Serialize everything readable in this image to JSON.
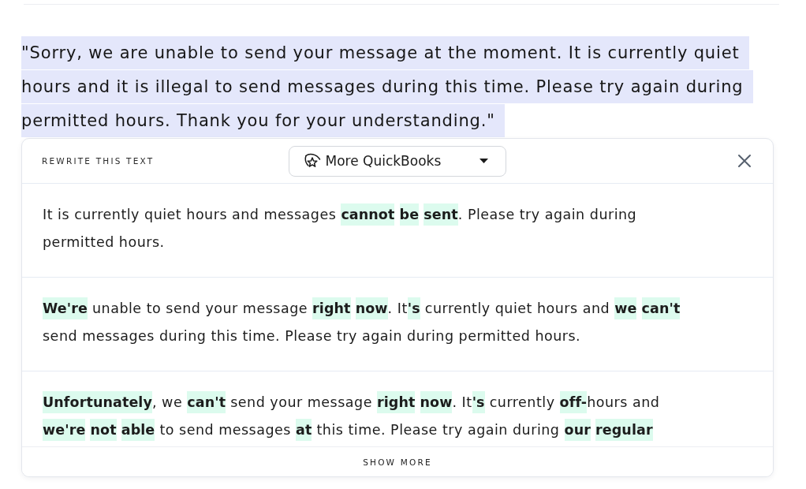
{
  "source_text": {
    "text": "\"Sorry, we are unable to send your message at the moment. It is currently quiet hours and it is illegal to send messages during this time. Please try again during permitted hours. Thank you for your understanding.\"",
    "selected": true
  },
  "rewrite_panel": {
    "title": "REWRITE THIS TEXT",
    "tone_dropdown": {
      "label": "More QuickBooks"
    },
    "suggestions": [
      "It is currently quiet hours and messages **cannot** **be** **sent**. Please try again during permitted hours.",
      "**We're** unable to send your message **right** **now**. It**'s** currently quiet hours and **we** **can't** send messages during this time. Please try again during permitted hours.",
      "**Unfortunately**, we **can't** send your message **right** **now**. It**'s** currently **off-**hours and **we're** **not** **able** to send messages **at** this time. Please try again during **our** **regular**"
    ],
    "show_more": "SHOW MORE"
  }
}
